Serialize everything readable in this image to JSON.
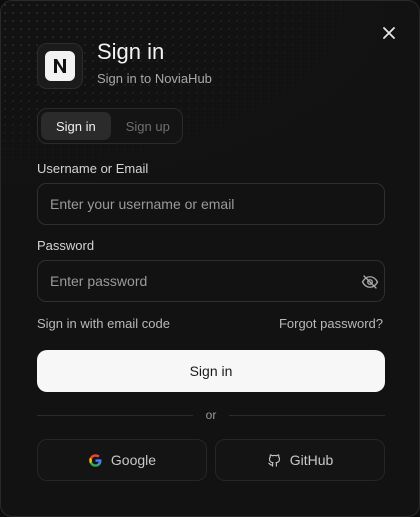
{
  "dialog": {
    "title": "Sign in",
    "subtitle": "Sign in to NoviaHub",
    "logo_letter": "N"
  },
  "tabs": [
    {
      "label": "Sign in",
      "active": true
    },
    {
      "label": "Sign up",
      "active": false
    }
  ],
  "form": {
    "username": {
      "label": "Username or Email",
      "placeholder": "Enter your username or email",
      "value": ""
    },
    "password": {
      "label": "Password",
      "placeholder": "Enter password",
      "value": ""
    },
    "email_code_link": "Sign in with email code",
    "forgot_link": "Forgot password?",
    "submit_label": "Sign in"
  },
  "divider_text": "or",
  "social": {
    "google_label": "Google",
    "github_label": "GitHub"
  },
  "icons": {
    "close": "close-icon",
    "logo": "noviahub-logo-icon",
    "eye_off": "eye-off-icon",
    "google": "google-icon",
    "github": "github-icon"
  },
  "colors": {
    "background": "#121212",
    "primary_button": "#f7f7f7",
    "text": "#e8e8e8",
    "muted": "#9a9a9a"
  }
}
